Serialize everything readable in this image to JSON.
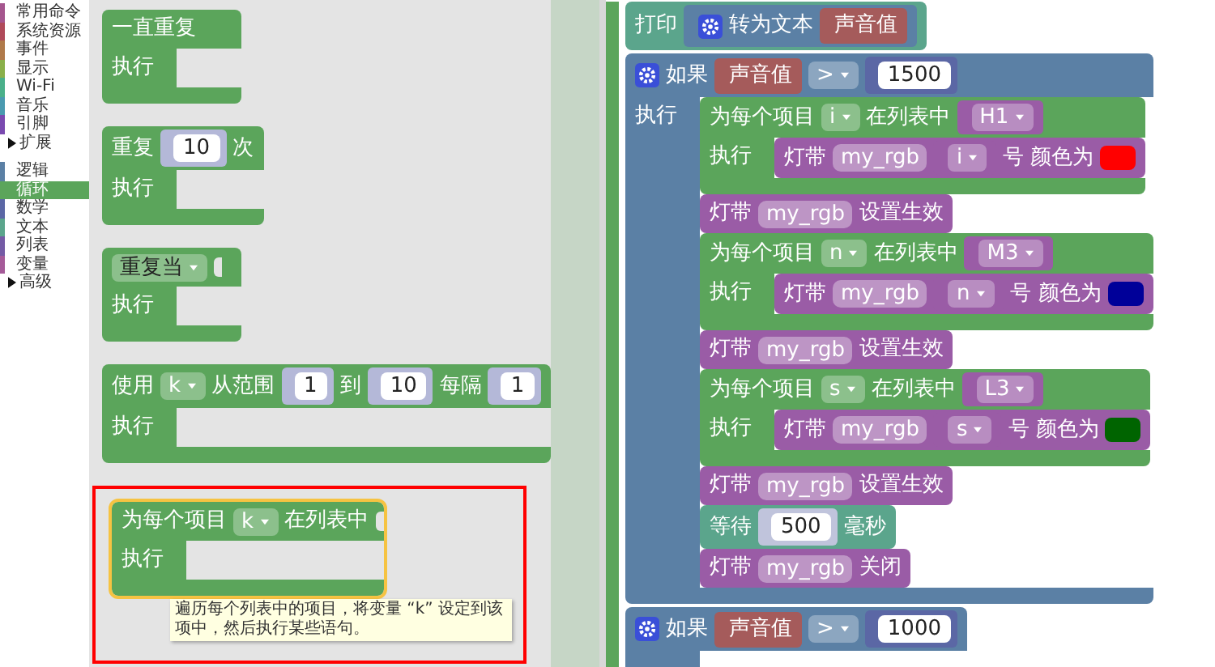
{
  "sidebar": {
    "groups": [
      [
        {
          "label": "常用命令",
          "color": "#a5568e",
          "selected": false,
          "expandable": false
        },
        {
          "label": "系统资源",
          "color": "#b04a5a",
          "selected": false,
          "expandable": false
        },
        {
          "label": "事件",
          "color": "#b07a4a",
          "selected": false,
          "expandable": false
        },
        {
          "label": "显示",
          "color": "#8ab04a",
          "selected": false,
          "expandable": false
        },
        {
          "label": "Wi-Fi",
          "color": "#4ab08a",
          "selected": false,
          "expandable": false
        },
        {
          "label": "音乐",
          "color": "#4a9ab0",
          "selected": false,
          "expandable": false
        },
        {
          "label": "引脚",
          "color": "#7a4ab0",
          "selected": false,
          "expandable": false
        },
        {
          "label": "扩展",
          "selected": false,
          "expandable": true
        }
      ],
      [
        {
          "label": "逻辑",
          "color": "#5b80a5",
          "selected": false,
          "expandable": false
        },
        {
          "label": "循环",
          "color": "#5ba55b",
          "selected": true,
          "expandable": false
        },
        {
          "label": "数学",
          "color": "#5b67a5",
          "selected": false,
          "expandable": false
        },
        {
          "label": "文本",
          "color": "#5ba58c",
          "selected": false,
          "expandable": false
        },
        {
          "label": "列表",
          "color": "#745ba5",
          "selected": false,
          "expandable": false
        },
        {
          "label": "变量",
          "color": "#a55b99",
          "selected": false,
          "expandable": false
        },
        {
          "label": "高级",
          "selected": false,
          "expandable": true
        }
      ]
    ]
  },
  "flyout": {
    "blocks": [
      {
        "kind": "c",
        "color": "#5ba55b",
        "highlighted": false,
        "header": [
          {
            "kind": "text",
            "text": "一直重复"
          }
        ],
        "body_label": "执行"
      },
      {
        "kind": "c",
        "color": "#5ba55b",
        "highlighted": false,
        "header": [
          {
            "kind": "text",
            "text": "重复"
          },
          {
            "kind": "number",
            "color": "#b4b8d8",
            "text": "10"
          },
          {
            "kind": "text",
            "text": "次"
          }
        ],
        "body_label": "执行"
      },
      {
        "kind": "c",
        "color": "#5ba55b",
        "highlighted": false,
        "header": [
          {
            "kind": "mode-dropdown",
            "text": "重复当"
          },
          {
            "kind": "socket"
          }
        ],
        "body_label": "执行"
      },
      {
        "kind": "c",
        "color": "#5ba55b",
        "highlighted": false,
        "header": [
          {
            "kind": "text",
            "text": "使用"
          },
          {
            "kind": "dropdown",
            "text": "k"
          },
          {
            "kind": "text",
            "text": "从范围"
          },
          {
            "kind": "number",
            "color": "#b4b8d8",
            "text": "1"
          },
          {
            "kind": "text",
            "text": "到"
          },
          {
            "kind": "number",
            "color": "#b4b8d8",
            "text": "10"
          },
          {
            "kind": "text",
            "text": "每隔"
          },
          {
            "kind": "number",
            "color": "#b4b8d8",
            "text": "1"
          }
        ],
        "body_label": "执行"
      },
      {
        "kind": "c",
        "color": "#5ba55b",
        "highlighted": true,
        "header": [
          {
            "kind": "text",
            "text": "为每个项目"
          },
          {
            "kind": "dropdown",
            "text": "k"
          },
          {
            "kind": "text",
            "text": "在列表中"
          },
          {
            "kind": "socket"
          }
        ],
        "body_label": "执行",
        "tooltip": "遍历每个列表中的项目，将变量 “k” 设定到该项中，然后执行某些语句。"
      }
    ]
  },
  "workspace": {
    "blocks": [
      {
        "kind": "stmt",
        "color": "#5ba58c",
        "header": [
          {
            "kind": "text",
            "text": "打印"
          },
          {
            "kind": "reporter",
            "color": "#5b80a5",
            "parts": [
              {
                "kind": "gear"
              },
              {
                "kind": "text",
                "text": "转为文本"
              },
              {
                "kind": "reporter",
                "color": "#a55b5b",
                "parts": [
                  {
                    "kind": "text",
                    "text": "声音值"
                  }
                ]
              }
            ]
          }
        ]
      },
      {
        "kind": "c",
        "color": "#5b80a5",
        "header": [
          {
            "kind": "gear"
          },
          {
            "kind": "text",
            "text": "如果"
          },
          {
            "kind": "reporter",
            "color": "#a55b5b",
            "parts": [
              {
                "kind": "text",
                "text": "声音值"
              }
            ]
          },
          {
            "kind": "dropdown",
            "text": ">"
          },
          {
            "kind": "number",
            "color": "#5b67a5",
            "text": "1500"
          }
        ],
        "body_label": "执行",
        "children": [
          {
            "kind": "c",
            "color": "#5ba55b",
            "header": [
              {
                "kind": "text",
                "text": "为每个项目"
              },
              {
                "kind": "dropdown",
                "text": "i"
              },
              {
                "kind": "text",
                "text": "在列表中"
              },
              {
                "kind": "reporter",
                "color": "#9a5ca6",
                "parts": [
                  {
                    "kind": "dropdown",
                    "text": "H1"
                  }
                ]
              }
            ],
            "body_label": "执行",
            "children": [
              {
                "kind": "stmt",
                "color": "#9a5ca6",
                "header": [
                  {
                    "kind": "text",
                    "text": "灯带"
                  },
                  {
                    "kind": "field",
                    "text": "my_rgb"
                  },
                  {
                    "kind": "reporter",
                    "color": "#9a5ca6",
                    "parts": [
                      {
                        "kind": "dropdown",
                        "text": "i"
                      }
                    ]
                  },
                  {
                    "kind": "text",
                    "text": "号 颜色为"
                  },
                  {
                    "kind": "swatch",
                    "color": "#ff0000"
                  }
                ]
              }
            ]
          },
          {
            "kind": "stmt",
            "color": "#9a5ca6",
            "header": [
              {
                "kind": "text",
                "text": "灯带"
              },
              {
                "kind": "field",
                "text": "my_rgb"
              },
              {
                "kind": "text",
                "text": "设置生效"
              }
            ]
          },
          {
            "kind": "c",
            "color": "#5ba55b",
            "header": [
              {
                "kind": "text",
                "text": "为每个项目"
              },
              {
                "kind": "dropdown",
                "text": "n"
              },
              {
                "kind": "text",
                "text": "在列表中"
              },
              {
                "kind": "reporter",
                "color": "#9a5ca6",
                "parts": [
                  {
                    "kind": "dropdown",
                    "text": "M3"
                  }
                ]
              }
            ],
            "body_label": "执行",
            "children": [
              {
                "kind": "stmt",
                "color": "#9a5ca6",
                "header": [
                  {
                    "kind": "text",
                    "text": "灯带"
                  },
                  {
                    "kind": "field",
                    "text": "my_rgb"
                  },
                  {
                    "kind": "reporter",
                    "color": "#9a5ca6",
                    "parts": [
                      {
                        "kind": "dropdown",
                        "text": "n"
                      }
                    ]
                  },
                  {
                    "kind": "text",
                    "text": "号 颜色为"
                  },
                  {
                    "kind": "swatch",
                    "color": "#000099"
                  }
                ]
              }
            ]
          },
          {
            "kind": "stmt",
            "color": "#9a5ca6",
            "header": [
              {
                "kind": "text",
                "text": "灯带"
              },
              {
                "kind": "field",
                "text": "my_rgb"
              },
              {
                "kind": "text",
                "text": "设置生效"
              }
            ]
          },
          {
            "kind": "c",
            "color": "#5ba55b",
            "header": [
              {
                "kind": "text",
                "text": "为每个项目"
              },
              {
                "kind": "dropdown",
                "text": "s"
              },
              {
                "kind": "text",
                "text": "在列表中"
              },
              {
                "kind": "reporter",
                "color": "#9a5ca6",
                "parts": [
                  {
                    "kind": "dropdown",
                    "text": "L3"
                  }
                ]
              }
            ],
            "body_label": "执行",
            "children": [
              {
                "kind": "stmt",
                "color": "#9a5ca6",
                "header": [
                  {
                    "kind": "text",
                    "text": "灯带"
                  },
                  {
                    "kind": "field",
                    "text": "my_rgb"
                  },
                  {
                    "kind": "reporter",
                    "color": "#9a5ca6",
                    "parts": [
                      {
                        "kind": "dropdown",
                        "text": "s"
                      }
                    ]
                  },
                  {
                    "kind": "text",
                    "text": "号 颜色为"
                  },
                  {
                    "kind": "swatch",
                    "color": "#006400"
                  }
                ]
              }
            ]
          },
          {
            "kind": "stmt",
            "color": "#9a5ca6",
            "header": [
              {
                "kind": "text",
                "text": "灯带"
              },
              {
                "kind": "field",
                "text": "my_rgb"
              },
              {
                "kind": "text",
                "text": "设置生效"
              }
            ]
          },
          {
            "kind": "stmt",
            "color": "#5ba58c",
            "header": [
              {
                "kind": "text",
                "text": "等待"
              },
              {
                "kind": "number",
                "color": "#c0c4dc",
                "text": "500"
              },
              {
                "kind": "text",
                "text": "毫秒"
              }
            ]
          },
          {
            "kind": "stmt",
            "color": "#9a5ca6",
            "header": [
              {
                "kind": "text",
                "text": "灯带"
              },
              {
                "kind": "field",
                "text": "my_rgb"
              },
              {
                "kind": "text",
                "text": "关闭"
              }
            ]
          }
        ]
      },
      {
        "kind": "c",
        "color": "#5b80a5",
        "header": [
          {
            "kind": "gear"
          },
          {
            "kind": "text",
            "text": "如果"
          },
          {
            "kind": "reporter",
            "color": "#a55b5b",
            "parts": [
              {
                "kind": "text",
                "text": "声音值"
              }
            ]
          },
          {
            "kind": "dropdown",
            "text": ">"
          },
          {
            "kind": "number",
            "color": "#5b67a5",
            "text": "1000"
          }
        ]
      }
    ]
  }
}
